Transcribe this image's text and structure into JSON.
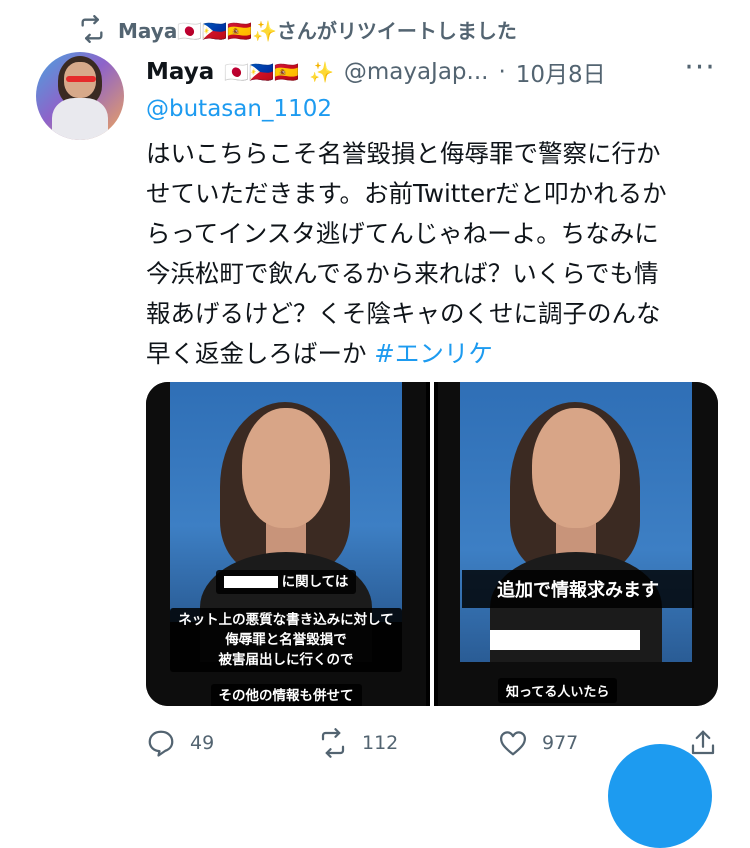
{
  "retweet": {
    "text": "Maya🇯🇵🇵🇭🇪🇸✨さんがリツイートしました",
    "icon": "retweet-icon"
  },
  "author": {
    "name": "Maya",
    "flags": "🇯🇵🇵🇭🇪🇸",
    "sparkle": "✨",
    "handle": "@mayaJap...",
    "dot": "·",
    "date": "10月8日"
  },
  "tweet": {
    "mention": "@butasan_1102",
    "lines": [
      "はいこちらこそ名誉毀損と侮辱罪で警察に行か",
      "せていただきます。お前Twitterだと叩かれるか",
      "らってインスタ逃げてんじゃねーよ。ちなみに",
      "今浜松町で飲んでるから来れば？いくらでも情",
      "報あげるけど？くそ陰キャのくせに調子のんな"
    ],
    "last_line": "早く返金しろばーか ",
    "hashtag": "#エンリケ"
  },
  "media": {
    "left": {
      "caption_top": "に関しては",
      "caption_lines": [
        "ネット上の悪質な書き込みに対して",
        "侮辱罪と名誉毀損で",
        "被害届出しに行くので"
      ],
      "caption_bottom": "その他の情報も併せて"
    },
    "right": {
      "caption": "追加で情報求みます",
      "caption_bottom": "知ってる人いたら"
    }
  },
  "actions": {
    "reply_count": "49",
    "retweet_count": "112",
    "like_count": "977"
  },
  "colors": {
    "accent": "#1d9bf0",
    "muted": "#536471",
    "text": "#0f1419"
  }
}
